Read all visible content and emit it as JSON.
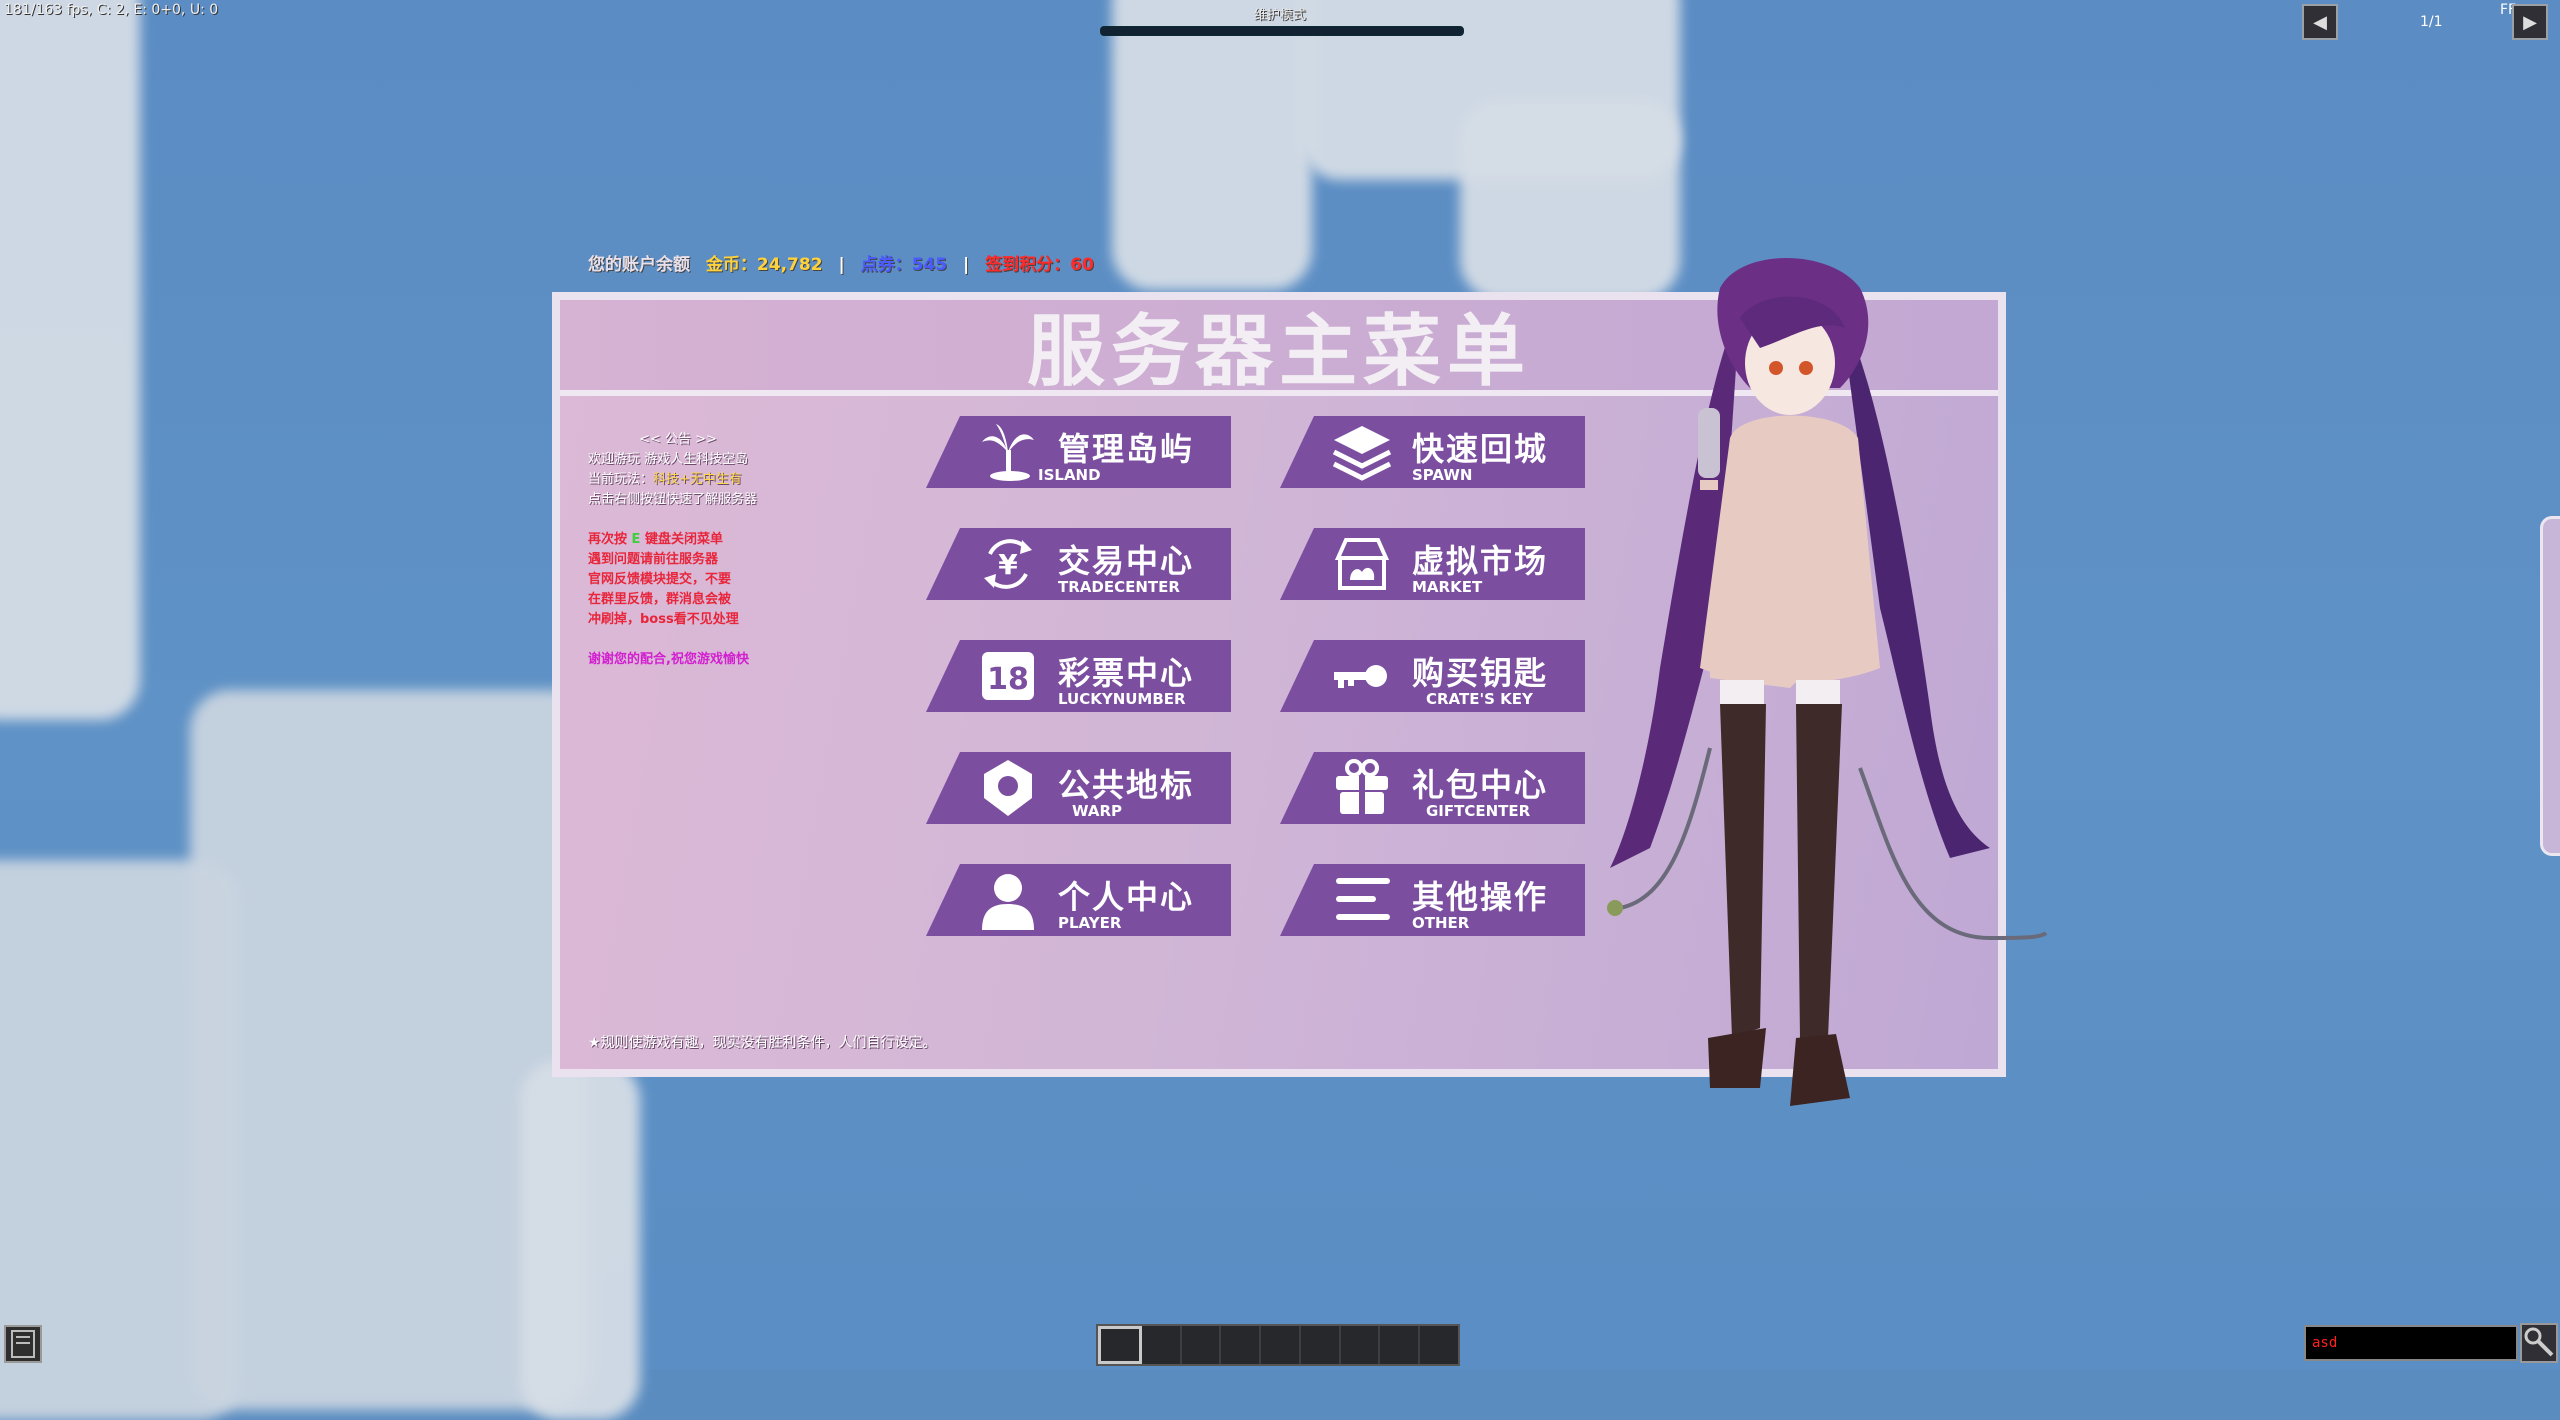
{
  "debug_text": "181/163 fps, C: 2, E: 0+0, U: 0",
  "bossbar_title": "维护模式",
  "pager": {
    "page": "1/1",
    "prev_icon": "triangle-left-icon",
    "next_icon": "triangle-right-icon",
    "edge_text": "FF"
  },
  "balance": {
    "label": "您的账户余额",
    "gold": "金币：24,782",
    "sep1": "|",
    "points": "点券：545",
    "sep2": "|",
    "checkin": "签到积分：60",
    "colors": {
      "gold": "#ffd23b",
      "points": "#4a5cff",
      "checkin": "#ff2a2a"
    }
  },
  "title": "服务器主菜单",
  "notice": {
    "heading": "<< 公告 >>",
    "welcome": "欢迎游玩 游戏人生科技空岛",
    "mode_label": "当前玩法：",
    "mode_value": "科技+无中生有",
    "hint": "点击右侧按钮快速了解服务器",
    "reopen_prefix": "再次按",
    "reopen_key": "E",
    "reopen_suffix": "键盘关闭菜单",
    "red1": "遇到问题请前往服务器",
    "red2": "官网反馈模块提交，不要",
    "red3": "在群里反馈，群消息会被",
    "red4": "冲刷掉，boss看不见处理",
    "thanks": "谢谢您的配合,祝您游戏愉快"
  },
  "footer": "★规则使游戏有趣，现实没有胜利条件，人们自行设定。",
  "menu": [
    {
      "cn": "管理岛屿",
      "en": "ISLAND",
      "icon": "palm-tree-icon"
    },
    {
      "cn": "快速回城",
      "en": "SPAWN",
      "icon": "layers-icon"
    },
    {
      "cn": "交易中心",
      "en": "TRADECENTER",
      "icon": "yen-exchange-icon"
    },
    {
      "cn": "虚拟市场",
      "en": "MARKET",
      "icon": "market-stall-icon"
    },
    {
      "cn": "彩票中心",
      "en": "LUCKYNUMBER",
      "icon": "lottery-18-icon"
    },
    {
      "cn": "购买钥匙",
      "en": "CRATE'S KEY",
      "icon": "key-icon"
    },
    {
      "cn": "公共地标",
      "en": "WARP",
      "icon": "map-pin-icon"
    },
    {
      "cn": "礼包中心",
      "en": "GIFTCENTER",
      "icon": "gift-icon"
    },
    {
      "cn": "个人中心",
      "en": "PLAYER",
      "icon": "user-icon"
    },
    {
      "cn": "其他操作",
      "en": "OTHER",
      "icon": "menu-lines-icon"
    }
  ],
  "lottery_number": "18",
  "chat_input": "asd",
  "hotbar": {
    "slots": 9,
    "selected": 1
  },
  "accent": "#7b4e9f"
}
